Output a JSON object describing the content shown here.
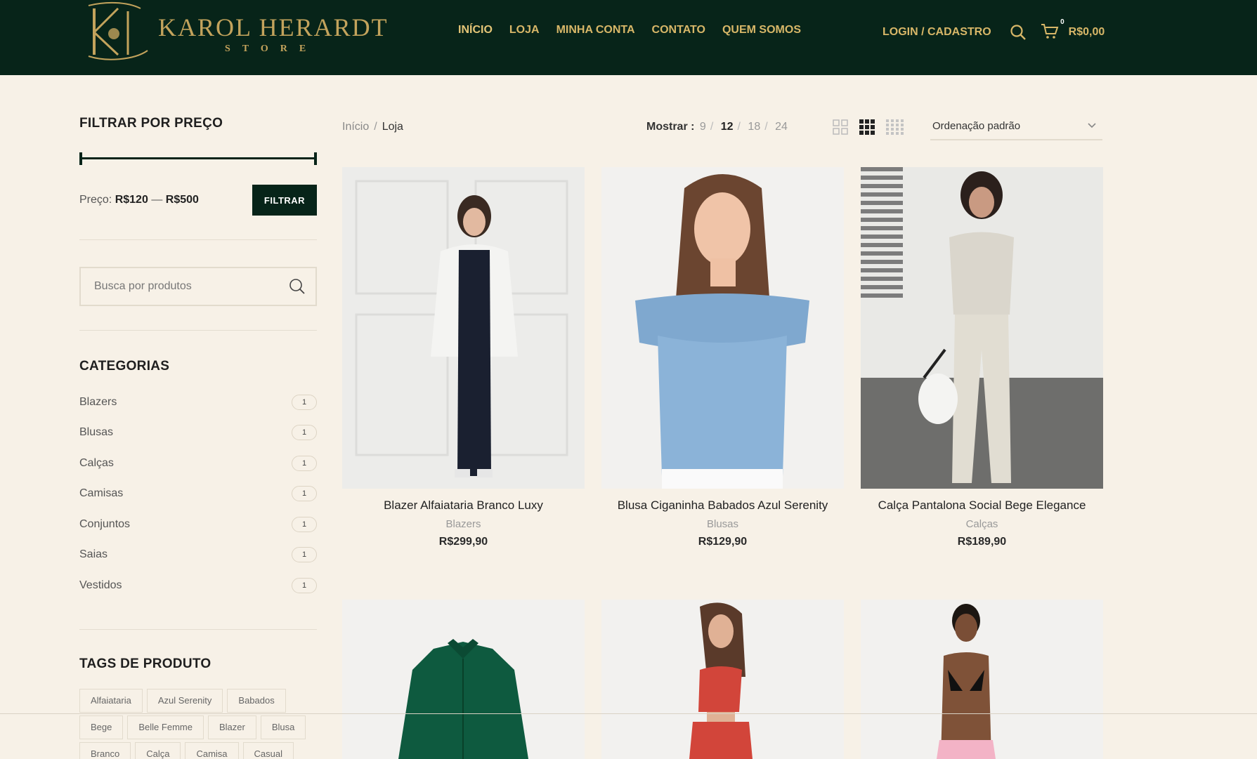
{
  "header": {
    "logo": {
      "initials": "KH",
      "name": "KAROL HERARDT",
      "sub": "STORE"
    },
    "nav": [
      {
        "label": "INÍCIO"
      },
      {
        "label": "LOJA"
      },
      {
        "label": "MINHA CONTA"
      },
      {
        "label": "CONTATO"
      },
      {
        "label": "QUEM SOMOS"
      }
    ],
    "login_label": "LOGIN / CADASTRO",
    "search_icon": "search-icon",
    "cart": {
      "icon": "cart-icon",
      "count": "0",
      "total": "R$0,00"
    }
  },
  "sidebar": {
    "price_filter": {
      "title": "FILTRAR POR PREÇO",
      "price_label": "Preço:",
      "min": "R$120",
      "separator": "—",
      "max": "R$500",
      "button": "FILTRAR",
      "range_fraction": [
        0.0,
        1.0
      ]
    },
    "search": {
      "placeholder": "Busca por produtos",
      "icon": "search-icon"
    },
    "categories": {
      "title": "CATEGORIAS",
      "items": [
        {
          "label": "Blazers",
          "count": "1"
        },
        {
          "label": "Blusas",
          "count": "1"
        },
        {
          "label": "Calças",
          "count": "1"
        },
        {
          "label": "Camisas",
          "count": "1"
        },
        {
          "label": "Conjuntos",
          "count": "1"
        },
        {
          "label": "Saias",
          "count": "1"
        },
        {
          "label": "Vestidos",
          "count": "1"
        }
      ]
    },
    "tags": {
      "title": "TAGS DE PRODUTO",
      "items": [
        "Alfaiataria",
        "Azul Serenity",
        "Babados",
        "Bege",
        "Belle Femme",
        "Blazer",
        "Blusa",
        "Branco",
        "Calça",
        "Camisa",
        "Casual"
      ]
    }
  },
  "toolbar": {
    "breadcrumb": {
      "home": "Início",
      "sep": "/",
      "current": "Loja"
    },
    "per_page": {
      "label": "Mostrar :",
      "options": [
        "9",
        "12",
        "18",
        "24"
      ],
      "selected": "12",
      "sep": "/"
    },
    "view_icons": [
      "grid-2-icon",
      "grid-3-icon",
      "grid-4-icon"
    ],
    "sort": {
      "label": "Ordenação padrão",
      "icon": "chevron-down-icon"
    }
  },
  "products": [
    {
      "name": "Blazer Alfaiataria Branco Luxy",
      "category": "Blazers",
      "price": "R$299,90"
    },
    {
      "name": "Blusa Ciganinha Babados Azul Serenity",
      "category": "Blusas",
      "price": "R$129,90"
    },
    {
      "name": "Calça Pantalona Social Bege Elegance",
      "category": "Calças",
      "price": "R$189,90"
    },
    {
      "name": "",
      "category": "",
      "price": ""
    },
    {
      "name": "",
      "category": "",
      "price": ""
    },
    {
      "name": "",
      "category": "",
      "price": ""
    }
  ],
  "colors": {
    "header_bg": "#072419",
    "gold": "#d8b768",
    "page_bg": "#f7f1e7"
  }
}
